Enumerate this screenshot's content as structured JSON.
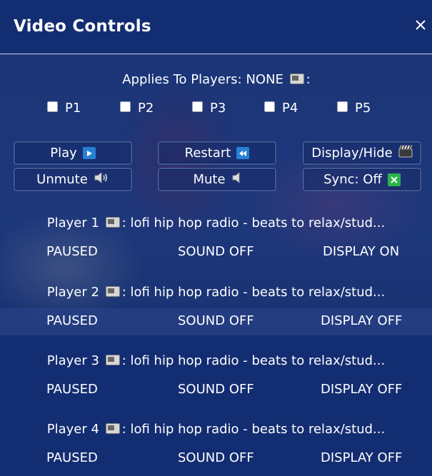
{
  "window": {
    "title": "Video Controls"
  },
  "applies": {
    "label": "Applies To Players: NONE",
    "suffix": ":"
  },
  "checkboxes": [
    {
      "label": "P1"
    },
    {
      "label": "P2"
    },
    {
      "label": "P3"
    },
    {
      "label": "P4"
    },
    {
      "label": "P5"
    }
  ],
  "buttons": {
    "play": "Play",
    "restart": "Restart",
    "display_hide": "Display/Hide",
    "unmute": "Unmute",
    "mute": "Mute",
    "sync": "Sync: Off"
  },
  "players": [
    {
      "label": "Player 1",
      "title": ": lofi hip hop radio - beats to relax/stud...",
      "play_state": "PAUSED",
      "sound": "SOUND OFF",
      "display": "DISPLAY ON"
    },
    {
      "label": "Player 2",
      "title": ": lofi hip hop radio - beats to relax/stud...",
      "play_state": "PAUSED",
      "sound": "SOUND OFF",
      "display": "DISPLAY OFF"
    },
    {
      "label": "Player 3",
      "title": ": lofi hip hop radio - beats to relax/stud...",
      "play_state": "PAUSED",
      "sound": "SOUND OFF",
      "display": "DISPLAY OFF"
    },
    {
      "label": "Player 4",
      "title": ": lofi hip hop radio - beats to relax/stud...",
      "play_state": "PAUSED",
      "sound": "SOUND OFF",
      "display": "DISPLAY OFF"
    }
  ],
  "icons": {
    "close": "close-icon",
    "tv": "tv-icon",
    "play": "play-icon",
    "rewind": "rewind-icon",
    "clapperboard": "clapperboard-icon",
    "speaker_loud": "speaker-loud-icon",
    "speaker": "speaker-icon",
    "sync_off": "x-box-icon"
  },
  "colors": {
    "background": "#132d72",
    "accent_blue": "#2680d8",
    "accent_green": "#28b34a"
  }
}
